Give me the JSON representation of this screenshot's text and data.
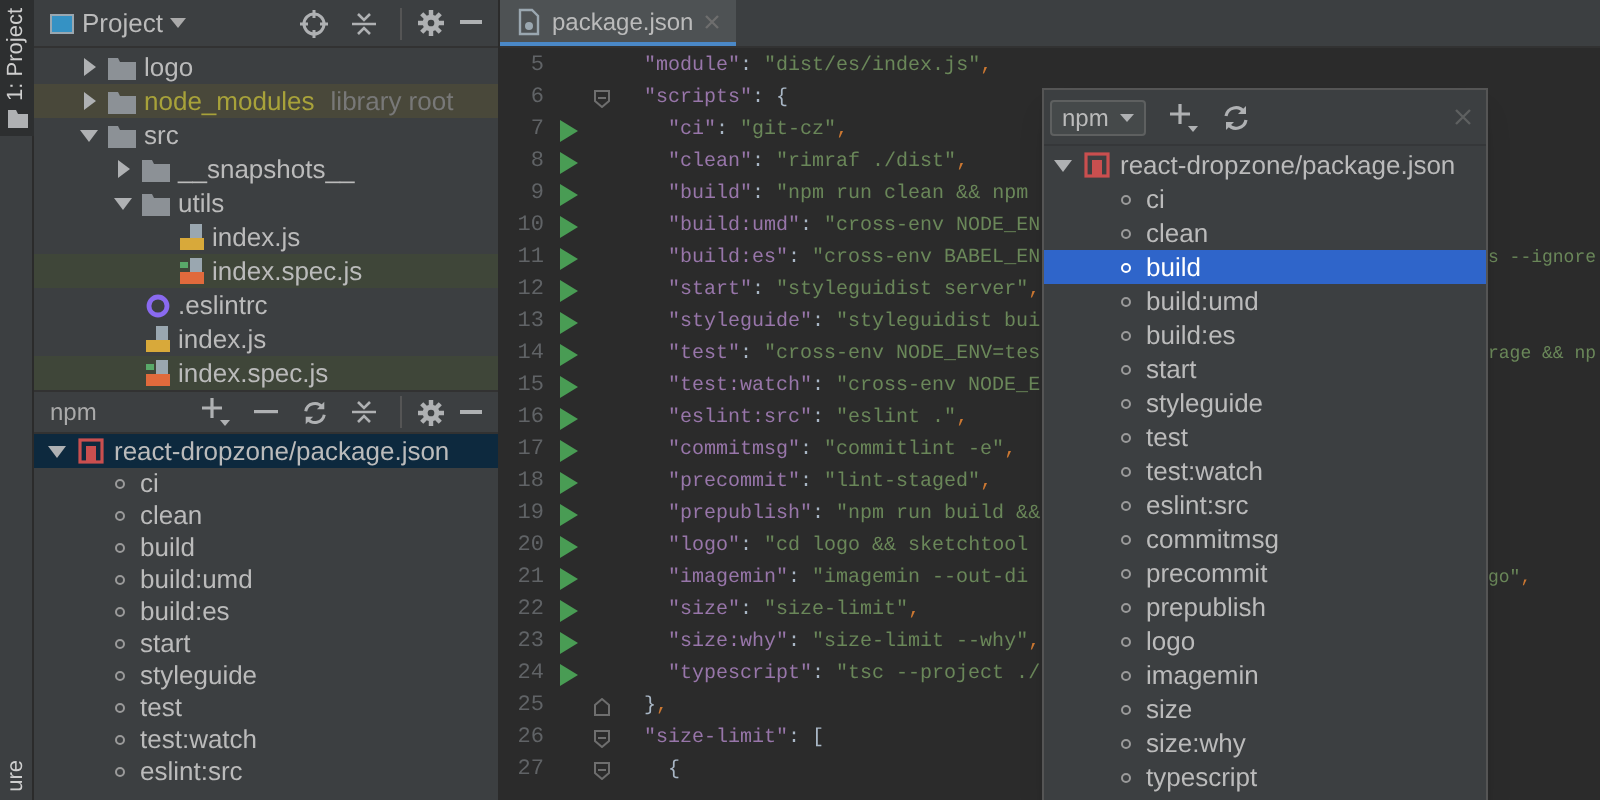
{
  "tool_stripe": {
    "tabs": [
      {
        "label": "1: Project",
        "selected": true
      },
      {
        "label": "ure",
        "selected": false
      }
    ]
  },
  "project_panel": {
    "title": "Project",
    "tree": [
      {
        "label": "logo",
        "kind": "folder",
        "expanded": false
      },
      {
        "label": "node_modules",
        "note": "library root",
        "kind": "library",
        "expanded": false
      },
      {
        "label": "src",
        "kind": "folder",
        "expanded": true,
        "children": [
          {
            "label": "__snapshots__",
            "kind": "folder",
            "expanded": false
          },
          {
            "label": "utils",
            "kind": "folder",
            "expanded": true,
            "children": [
              {
                "label": "index.js",
                "kind": "js"
              },
              {
                "label": "index.spec.js",
                "kind": "spec"
              }
            ]
          },
          {
            "label": ".eslintrc",
            "kind": "config"
          },
          {
            "label": "index.js",
            "kind": "js"
          },
          {
            "label": "index.spec.js",
            "kind": "spec"
          }
        ]
      }
    ]
  },
  "npm_panel": {
    "title": "npm",
    "tree": [
      {
        "label": "react-dropzone/package.json",
        "expanded": true,
        "selected": true,
        "children": [
          {
            "label": "ci",
            "selected": false
          },
          {
            "label": "clean",
            "selected": false
          },
          {
            "label": "build",
            "selected": false
          },
          {
            "label": "build:umd",
            "selected": false
          },
          {
            "label": "build:es",
            "selected": false
          },
          {
            "label": "start",
            "selected": false
          },
          {
            "label": "styleguide",
            "selected": false
          },
          {
            "label": "test",
            "selected": false
          },
          {
            "label": "test:watch",
            "selected": false
          },
          {
            "label": "eslint:src",
            "selected": false
          }
        ]
      }
    ]
  },
  "editor": {
    "tabs": [
      {
        "label": "package.json",
        "selected": true
      }
    ],
    "lines": [
      {
        "number": "5",
        "text": "  \"module\": \"dist/es/index.js\",",
        "run": false,
        "fold_open": false,
        "fold_close": false
      },
      {
        "number": "6",
        "text": "  \"scripts\": {",
        "run": false,
        "fold_open": true,
        "fold_close": false
      },
      {
        "number": "7",
        "text": "    \"ci\": \"git-cz\",",
        "run": true,
        "fold_open": false,
        "fold_close": false
      },
      {
        "number": "8",
        "text": "    \"clean\": \"rimraf ./dist\",",
        "run": true,
        "fold_open": false,
        "fold_close": false
      },
      {
        "number": "9",
        "text": "    \"build\": \"npm run clean && npm",
        "run": true,
        "fold_open": false,
        "fold_close": false
      },
      {
        "number": "10",
        "text": "    \"build:umd\": \"cross-env NODE_EN",
        "run": true,
        "fold_open": false,
        "fold_close": false
      },
      {
        "number": "11",
        "text": "    \"build:es\": \"cross-env BABEL_EN",
        "tail": "s --ignore",
        "run": true,
        "fold_open": false,
        "fold_close": false
      },
      {
        "number": "12",
        "text": "    \"start\": \"styleguidist server\",",
        "run": true,
        "fold_open": false,
        "fold_close": false
      },
      {
        "number": "13",
        "text": "    \"styleguide\": \"styleguidist bui",
        "run": true,
        "fold_open": false,
        "fold_close": false
      },
      {
        "number": "14",
        "text": "    \"test\": \"cross-env NODE_ENV=tes",
        "tail": "rage && np",
        "run": true,
        "fold_open": false,
        "fold_close": false
      },
      {
        "number": "15",
        "text": "    \"test:watch\": \"cross-env NODE_E",
        "run": true,
        "fold_open": false,
        "fold_close": false
      },
      {
        "number": "16",
        "text": "    \"eslint:src\": \"eslint .\",",
        "run": true,
        "fold_open": false,
        "fold_close": false
      },
      {
        "number": "17",
        "text": "    \"commitmsg\": \"commitlint -e\",",
        "run": true,
        "fold_open": false,
        "fold_close": false
      },
      {
        "number": "18",
        "text": "    \"precommit\": \"lint-staged\",",
        "run": true,
        "fold_open": false,
        "fold_close": false
      },
      {
        "number": "19",
        "text": "    \"prepublish\": \"npm run build &&",
        "run": true,
        "fold_open": false,
        "fold_close": false
      },
      {
        "number": "20",
        "text": "    \"logo\": \"cd logo && sketchtool",
        "run": true,
        "fold_open": false,
        "fold_close": false
      },
      {
        "number": "21",
        "text": "    \"imagemin\": \"imagemin --out-di",
        "tail": "go\",",
        "run": true,
        "fold_open": false,
        "fold_close": false
      },
      {
        "number": "22",
        "text": "    \"size\": \"size-limit\",",
        "run": true,
        "fold_open": false,
        "fold_close": false
      },
      {
        "number": "23",
        "text": "    \"size:why\": \"size-limit --why\",",
        "run": true,
        "fold_open": false,
        "fold_close": false
      },
      {
        "number": "24",
        "text": "    \"typescript\": \"tsc --project ./",
        "run": true,
        "fold_open": false,
        "fold_close": false
      },
      {
        "number": "25",
        "text": "  },",
        "run": false,
        "fold_open": false,
        "fold_close": true
      },
      {
        "number": "26",
        "text": "  \"size-limit\": [",
        "run": false,
        "fold_open": true,
        "fold_close": false
      },
      {
        "number": "27",
        "text": "    {",
        "run": false,
        "fold_open": true,
        "fold_close": false
      }
    ]
  },
  "popup": {
    "dropdown": "npm",
    "tree": [
      {
        "label": "react-dropzone/package.json",
        "expanded": true,
        "selected": false,
        "children": [
          {
            "label": "ci",
            "selected": false
          },
          {
            "label": "clean",
            "selected": false
          },
          {
            "label": "build",
            "selected": true
          },
          {
            "label": "build:umd",
            "selected": false
          },
          {
            "label": "build:es",
            "selected": false
          },
          {
            "label": "start",
            "selected": false
          },
          {
            "label": "styleguide",
            "selected": false
          },
          {
            "label": "test",
            "selected": false
          },
          {
            "label": "test:watch",
            "selected": false
          },
          {
            "label": "eslint:src",
            "selected": false
          },
          {
            "label": "commitmsg",
            "selected": false
          },
          {
            "label": "precommit",
            "selected": false
          },
          {
            "label": "prepublish",
            "selected": false
          },
          {
            "label": "logo",
            "selected": false
          },
          {
            "label": "imagemin",
            "selected": false
          },
          {
            "label": "size",
            "selected": false
          },
          {
            "label": "size:why",
            "selected": false
          },
          {
            "label": "typescript",
            "selected": false
          }
        ]
      }
    ]
  }
}
